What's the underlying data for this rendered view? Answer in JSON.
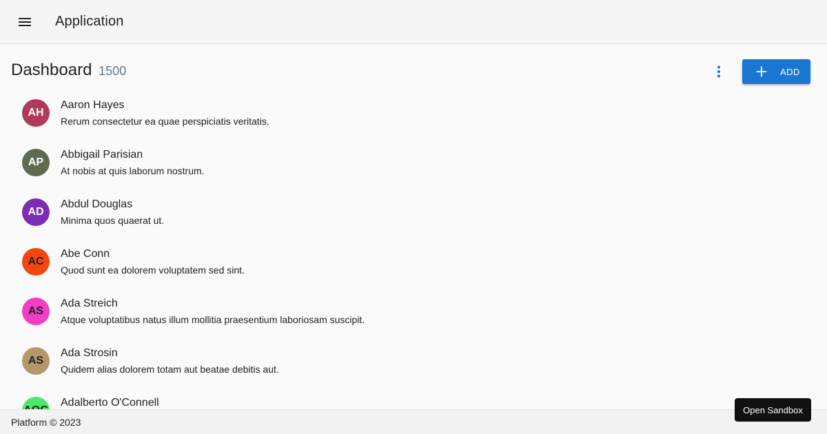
{
  "appbar": {
    "menu_icon": "menu-icon",
    "title": "Application"
  },
  "toolbar": {
    "title": "Dashboard",
    "count": "1500",
    "more_icon": "more-vert-icon",
    "add_icon": "plus-icon",
    "add_label": "ADD"
  },
  "colors": {
    "primary": "#1976d2",
    "appbar_bg": "#f5f5f5",
    "count_text": "#5f7a8a"
  },
  "list": {
    "items": [
      {
        "initials": "AH",
        "name": "Aaron Hayes",
        "description": "Rerum consectetur ea quae perspiciatis veritatis.",
        "avatar_color": "#b03a5b",
        "avatar_text_color": "#ffffff"
      },
      {
        "initials": "AP",
        "name": "Abbigail Parisian",
        "description": "At nobis at quis laborum nostrum.",
        "avatar_color": "#5f6b4e",
        "avatar_text_color": "#ffffff"
      },
      {
        "initials": "AD",
        "name": "Abdul Douglas",
        "description": "Minima quos quaerat ut.",
        "avatar_color": "#7b2eb3",
        "avatar_text_color": "#ffffff"
      },
      {
        "initials": "AC",
        "name": "Abe Conn",
        "description": "Quod sunt ea dolorem voluptatem sed sint.",
        "avatar_color": "#f4460e",
        "avatar_text_color": "#212121"
      },
      {
        "initials": "AS",
        "name": "Ada Streich",
        "description": "Atque voluptatibus natus illum mollitia praesentium laboriosam suscipit.",
        "avatar_color": "#f23ec5",
        "avatar_text_color": "#212121"
      },
      {
        "initials": "AS",
        "name": "Ada Strosin",
        "description": "Quidem alias dolorem totam aut beatae debitis aut.",
        "avatar_color": "#b5976c",
        "avatar_text_color": "#212121"
      },
      {
        "initials": "AOC",
        "name": "Adalberto O'Connell",
        "description": "",
        "avatar_color": "#4be86a",
        "avatar_text_color": "#212121"
      }
    ]
  },
  "footer": {
    "text": "Platform © 2023"
  },
  "sandbox": {
    "label": "Open Sandbox"
  }
}
